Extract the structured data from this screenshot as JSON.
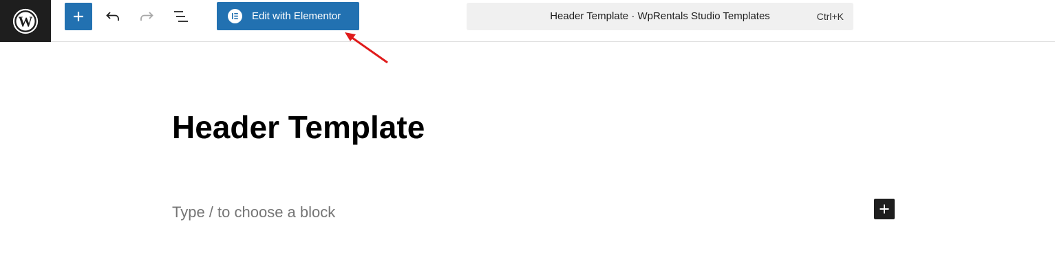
{
  "toolbar": {
    "edit_with_elementor_label": "Edit with Elementor",
    "accent_color": "#2271b1"
  },
  "command_bar": {
    "title": "Header Template · WpRentals Studio Templates",
    "shortcut": "Ctrl+K"
  },
  "editor": {
    "title": "Header Template",
    "block_placeholder": "Type / to choose a block"
  },
  "icons": [
    "wordpress-logo-icon",
    "plus-icon",
    "undo-icon",
    "redo-icon",
    "document-overview-icon",
    "elementor-icon",
    "red-arrow-annotation-icon"
  ]
}
